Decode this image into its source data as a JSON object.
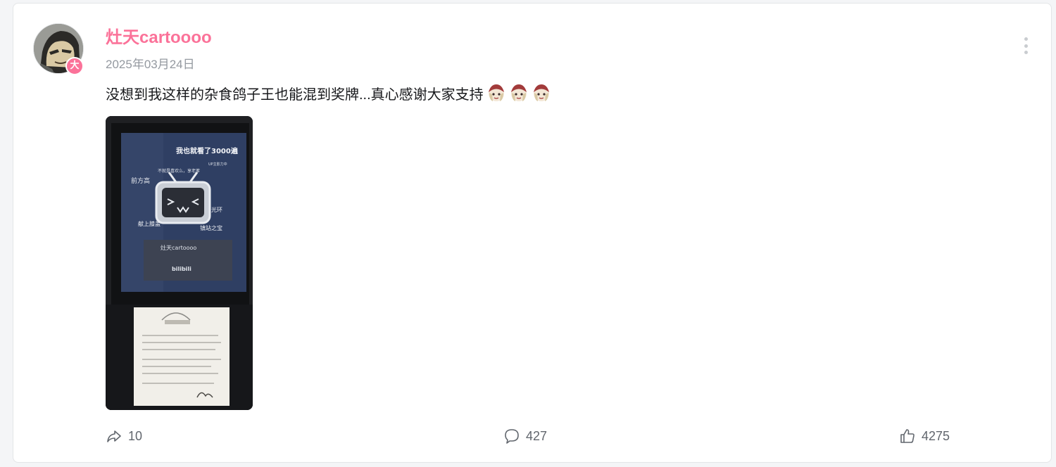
{
  "post": {
    "author": {
      "name": "灶天cartoooo",
      "badge": "大",
      "avatar": "avatar-portrait"
    },
    "date": "2025年03月24日",
    "content": {
      "text": "没想到我这样的杂食鸽子王也能混到奖牌...真心感谢大家支持",
      "emojis": [
        "emoji-character",
        "emoji-character",
        "emoji-character"
      ]
    },
    "image": {
      "subject": "award-plaque-photo",
      "headline": "我也就看了3000遍",
      "name_plate": "灶天cartoooo",
      "words": [
        "UP主影力中",
        "光环",
        "前方高",
        "献上膝盖",
        "镇站之宝",
        "不就是喜欢么，享老爹"
      ],
      "brand": "bilibili"
    },
    "stats": {
      "forward": "10",
      "comment": "427",
      "like": "4275"
    }
  },
  "colors": {
    "accent": "#fb7299",
    "secondary_text": "#9499a0",
    "text": "#18191c",
    "action_text": "#61666d"
  },
  "icons": {
    "more": "more-vertical-icon",
    "forward": "forward-icon",
    "comment": "comment-icon",
    "like": "thumb-up-icon"
  }
}
